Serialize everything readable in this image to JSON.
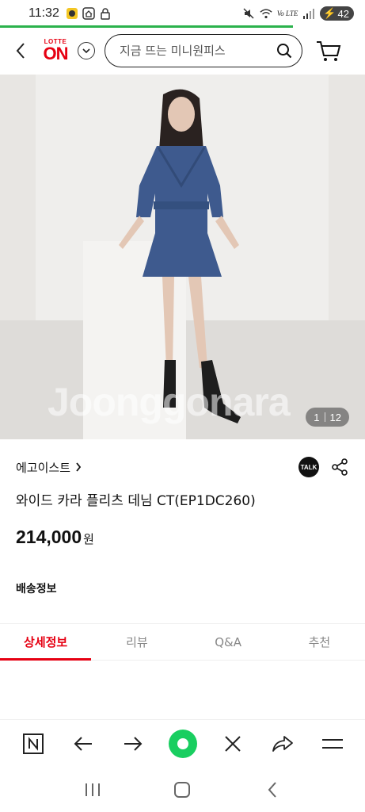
{
  "status_bar": {
    "time": "11:32",
    "battery": "42",
    "network": "Vo LTE"
  },
  "header": {
    "logo_top": "LOTTE",
    "logo_main": "ON",
    "search_placeholder": "지금 뜨는 미니원피스"
  },
  "gallery": {
    "current": "1",
    "total": "12",
    "watermark": "Joonggonara"
  },
  "product": {
    "brand": "에고이스트",
    "talk_label": "TALK",
    "title": "와이드 카라 플리츠 데님 CT(EP1DC260)",
    "price": "214,000",
    "price_unit": "원",
    "shipping_label": "배송정보"
  },
  "tabs": [
    {
      "label": "상세정보",
      "active": true
    },
    {
      "label": "리뷰",
      "active": false
    },
    {
      "label": "Q&A",
      "active": false
    },
    {
      "label": "추천",
      "active": false
    }
  ],
  "colors": {
    "brand_red": "#e60012",
    "loading_green": "#2bb24c",
    "naver_green": "#19ce60"
  }
}
